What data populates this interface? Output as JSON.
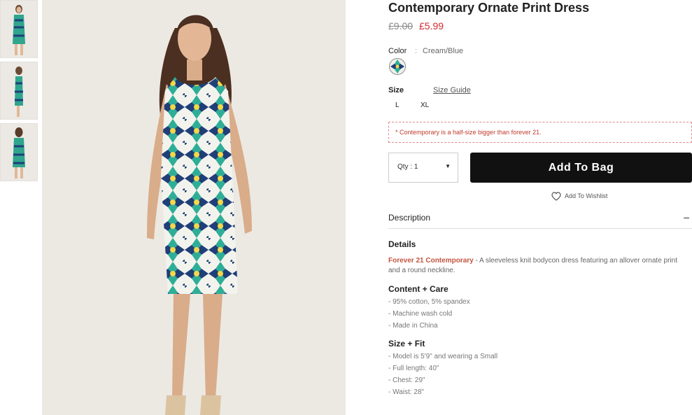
{
  "product": {
    "title": "Contemporary Ornate Print Dress",
    "price_original": "£9.00",
    "price_sale": "£5.99"
  },
  "color": {
    "label": "Color",
    "separator": ":",
    "value": "Cream/Blue"
  },
  "size": {
    "label": "Size",
    "guide_link": "Size Guide",
    "options": [
      "L",
      "XL"
    ]
  },
  "notice": "* Contemporary is a half-size bigger than forever 21.",
  "qty": {
    "label": "Qty : 1"
  },
  "add_to_bag": "Add To Bag",
  "wishlist": "Add To Wishlist",
  "description": {
    "heading": "Description",
    "toggle": "–",
    "details": {
      "heading": "Details",
      "brand": "Forever 21 Contemporary",
      "text": " - A sleeveless knit bodycon dress featuring an allover ornate print and a round neckline."
    },
    "content_care": {
      "heading": "Content + Care",
      "items": [
        "- 95% cotton, 5% spandex",
        "- Machine wash cold",
        "- Made in China"
      ]
    },
    "size_fit": {
      "heading": "Size + Fit",
      "items": [
        "- Model is 5'9\" and wearing a Small",
        "- Full length: 40\"",
        "- Chest: 29\"",
        "- Waist: 28\""
      ]
    }
  },
  "colors": {
    "sale": "#d4282f",
    "button": "#111111",
    "brand": "#c4553f"
  }
}
